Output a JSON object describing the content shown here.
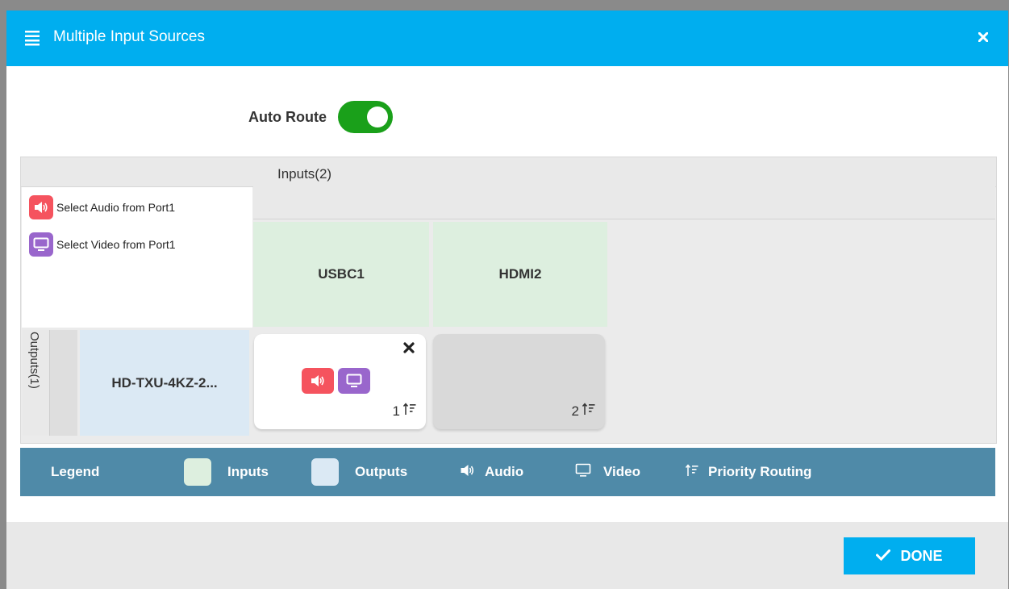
{
  "dialog": {
    "title": "Multiple Input Sources",
    "header_color": "#00aeef"
  },
  "auto_route": {
    "label": "Auto Route",
    "enabled": true,
    "color": "#1aa01a"
  },
  "matrix": {
    "inputs_header": "Inputs(2)",
    "outputs_header": "Outputs(1)",
    "select_audio_label": "Select Audio from Port1",
    "select_video_label": "Select Video from Port1",
    "inputs": [
      {
        "name": "USBC1"
      },
      {
        "name": "HDMI2"
      }
    ],
    "outputs": [
      {
        "name": "HD-TXU-4KZ-2..."
      }
    ],
    "routes": [
      {
        "priority": "1",
        "active": true,
        "audio": true,
        "video": true
      },
      {
        "priority": "2",
        "active": false,
        "audio": false,
        "video": false
      }
    ]
  },
  "legend": {
    "title": "Legend",
    "inputs": "Inputs",
    "outputs": "Outputs",
    "audio": "Audio",
    "video": "Video",
    "priority": "Priority Routing",
    "inputs_color": "#ddefdf",
    "outputs_color": "#dbe9f4",
    "bar_color": "#4f8aa8"
  },
  "footer": {
    "done_label": "DONE"
  },
  "icons": {
    "header": "list-icon",
    "close": "close-icon",
    "audio": "speaker-icon",
    "video": "monitor-icon",
    "priority": "priority-sort-icon",
    "done": "check-icon"
  }
}
